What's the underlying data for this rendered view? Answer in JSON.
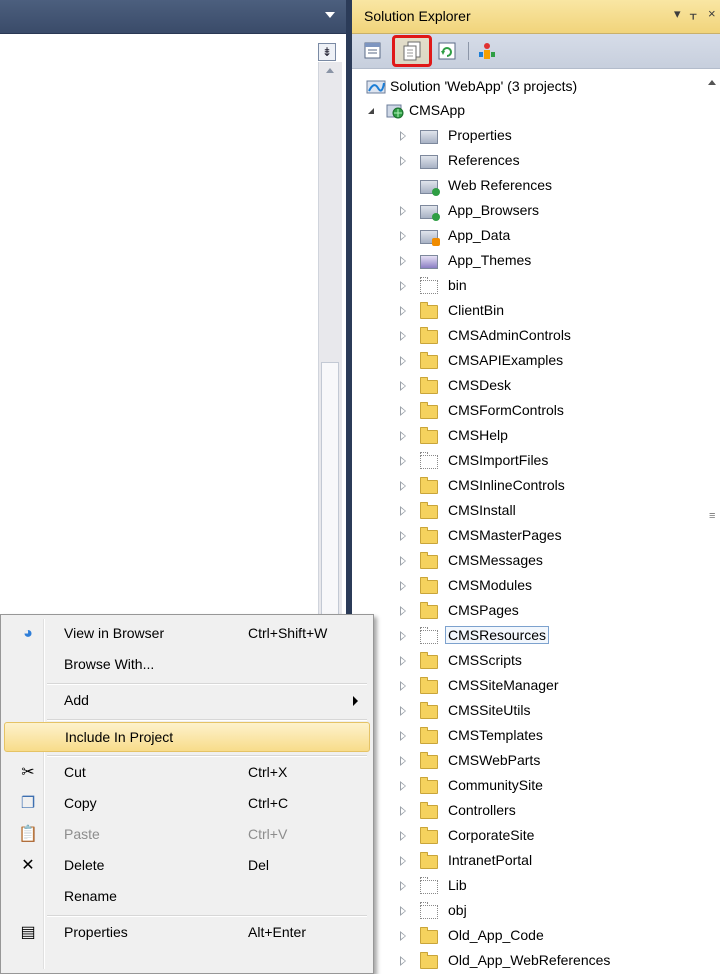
{
  "solution_explorer": {
    "title": "Solution Explorer",
    "controls": {
      "dropdown": "▾",
      "pin": "ᚁ",
      "close": "×"
    },
    "toolbar": [
      {
        "name": "properties-icon"
      },
      {
        "name": "show-all-files-icon",
        "highlighted": true
      },
      {
        "name": "refresh-icon"
      },
      {
        "name": "class-diagram-icon"
      }
    ],
    "tree": {
      "solution": "Solution 'WebApp' (3 projects)",
      "project": "CMSApp",
      "items": [
        {
          "label": "Properties",
          "icon": "special",
          "expander": true
        },
        {
          "label": "References",
          "icon": "special",
          "expander": true
        },
        {
          "label": "Web References",
          "icon": "special-green",
          "expander": false
        },
        {
          "label": "App_Browsers",
          "icon": "special-green",
          "expander": true
        },
        {
          "label": "App_Data",
          "icon": "special-orange",
          "expander": true
        },
        {
          "label": "App_Themes",
          "icon": "special-purple",
          "expander": true
        },
        {
          "label": "bin",
          "icon": "folder-empty",
          "expander": true
        },
        {
          "label": "ClientBin",
          "icon": "folder",
          "expander": true
        },
        {
          "label": "CMSAdminControls",
          "icon": "folder",
          "expander": true
        },
        {
          "label": "CMSAPIExamples",
          "icon": "folder",
          "expander": true
        },
        {
          "label": "CMSDesk",
          "icon": "folder",
          "expander": true
        },
        {
          "label": "CMSFormControls",
          "icon": "folder",
          "expander": true
        },
        {
          "label": "CMSHelp",
          "icon": "folder",
          "expander": true
        },
        {
          "label": "CMSImportFiles",
          "icon": "folder-empty",
          "expander": true
        },
        {
          "label": "CMSInlineControls",
          "icon": "folder",
          "expander": true
        },
        {
          "label": "CMSInstall",
          "icon": "folder",
          "expander": true
        },
        {
          "label": "CMSMasterPages",
          "icon": "folder",
          "expander": true
        },
        {
          "label": "CMSMessages",
          "icon": "folder",
          "expander": true
        },
        {
          "label": "CMSModules",
          "icon": "folder",
          "expander": true
        },
        {
          "label": "CMSPages",
          "icon": "folder",
          "expander": true
        },
        {
          "label": "CMSResources",
          "icon": "folder-empty",
          "expander": true,
          "selected": true
        },
        {
          "label": "CMSScripts",
          "icon": "folder",
          "expander": true
        },
        {
          "label": "CMSSiteManager",
          "icon": "folder",
          "expander": true
        },
        {
          "label": "CMSSiteUtils",
          "icon": "folder",
          "expander": true
        },
        {
          "label": "CMSTemplates",
          "icon": "folder",
          "expander": true
        },
        {
          "label": "CMSWebParts",
          "icon": "folder",
          "expander": true
        },
        {
          "label": "CommunitySite",
          "icon": "folder",
          "expander": true
        },
        {
          "label": "Controllers",
          "icon": "folder",
          "expander": true
        },
        {
          "label": "CorporateSite",
          "icon": "folder",
          "expander": true
        },
        {
          "label": "IntranetPortal",
          "icon": "folder",
          "expander": true
        },
        {
          "label": "Lib",
          "icon": "folder-empty",
          "expander": true
        },
        {
          "label": "obj",
          "icon": "folder-empty",
          "expander": true
        },
        {
          "label": "Old_App_Code",
          "icon": "folder",
          "expander": true
        },
        {
          "label": "Old_App_WebReferences",
          "icon": "folder",
          "expander": true
        }
      ]
    }
  },
  "editor": {
    "split_glyph": "⇟"
  },
  "context_menu": {
    "items": [
      {
        "label": "View in Browser",
        "shortcut": "Ctrl+Shift+W",
        "icon": "browser-icon",
        "glyph": "◕"
      },
      {
        "label": "Browse With...",
        "shortcut": "",
        "icon": "",
        "glyph": ""
      },
      {
        "separator": true
      },
      {
        "label": "Add",
        "shortcut": "",
        "icon": "",
        "glyph": "",
        "submenu": true
      },
      {
        "separator": true
      },
      {
        "label": "Include In Project",
        "shortcut": "",
        "icon": "",
        "glyph": "",
        "hover": true
      },
      {
        "separator": true
      },
      {
        "label": "Cut",
        "shortcut": "Ctrl+X",
        "icon": "scissors-icon",
        "glyph": "✂"
      },
      {
        "label": "Copy",
        "shortcut": "Ctrl+C",
        "icon": "copy-icon",
        "glyph": "❐"
      },
      {
        "label": "Paste",
        "shortcut": "Ctrl+V",
        "icon": "paste-icon",
        "glyph": "📋",
        "disabled": true
      },
      {
        "label": "Delete",
        "shortcut": "Del",
        "icon": "delete-icon",
        "glyph": "✕"
      },
      {
        "label": "Rename",
        "shortcut": "",
        "icon": "",
        "glyph": ""
      },
      {
        "separator": true
      },
      {
        "label": "Properties",
        "shortcut": "Alt+Enter",
        "icon": "properties-icon",
        "glyph": "▤"
      }
    ]
  }
}
